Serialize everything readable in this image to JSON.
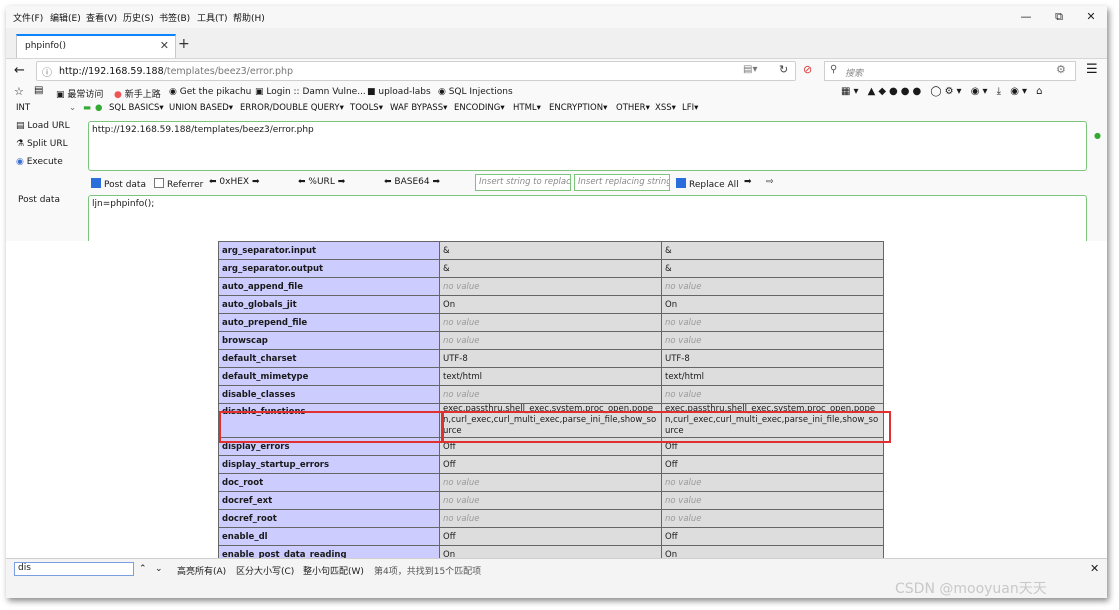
{
  "menubar": {
    "items": [
      "文件(F)",
      "编辑(E)",
      "查看(V)",
      "历史(S)",
      "书签(B)",
      "工具(T)",
      "帮助(H)"
    ]
  },
  "tab": {
    "title": "phpinfo()"
  },
  "nav": {
    "url_host": "http://192.168.59.188",
    "url_path": "/templates/beez3/error.php",
    "search_placeholder": "搜索"
  },
  "bookmarks": [
    "最常访问",
    "新手上路",
    "Get the pikachu",
    "Login :: Damn Vulne...",
    "upload-labs",
    "SQL Injections"
  ],
  "hackbar": {
    "type_select": "INT",
    "menu": [
      "SQL BASICS",
      "UNION BASED",
      "ERROR/DOUBLE QUERY",
      "TOOLS",
      "WAF BYPASS",
      "ENCODING",
      "HTML",
      "ENCRYPTION",
      "OTHER",
      "XSS",
      "LFI"
    ],
    "load_url": "Load URL",
    "split_url": "Split URL",
    "execute": "Execute",
    "url_value": "http://192.168.59.188/templates/beez3/error.php",
    "post_data_label": "Post data",
    "referrer_label": "Referrer",
    "hex_label": "0xHEX",
    "url_enc_label": "%URL",
    "base64_label": "BASE64",
    "insert_string_placeholder": "Insert string to replace",
    "insert_replacing_placeholder": "Insert replacing string",
    "replace_all_label": "Replace All",
    "post_side_label": "Post data",
    "post_value": "ljn=phpinfo();"
  },
  "phpinfo": {
    "rows": [
      {
        "key": "arg_separator.input",
        "local": "&",
        "master": "&"
      },
      {
        "key": "arg_separator.output",
        "local": "&",
        "master": "&"
      },
      {
        "key": "auto_append_file",
        "local": "no value",
        "master": "no value"
      },
      {
        "key": "auto_globals_jit",
        "local": "On",
        "master": "On"
      },
      {
        "key": "auto_prepend_file",
        "local": "no value",
        "master": "no value"
      },
      {
        "key": "browscap",
        "local": "no value",
        "master": "no value"
      },
      {
        "key": "default_charset",
        "local": "UTF-8",
        "master": "UTF-8"
      },
      {
        "key": "default_mimetype",
        "local": "text/html",
        "master": "text/html"
      },
      {
        "key": "disable_classes",
        "local": "no value",
        "master": "no value"
      },
      {
        "key": "disable_functions",
        "local": "exec,passthru,shell_exec,system,proc_open,popen,curl_exec,curl_multi_exec,parse_ini_file,show_source",
        "master": "exec,passthru,shell_exec,system,proc_open,popen,curl_exec,curl_multi_exec,parse_ini_file,show_source"
      },
      {
        "key": "display_errors",
        "local": "Off",
        "master": "Off"
      },
      {
        "key": "display_startup_errors",
        "local": "Off",
        "master": "Off"
      },
      {
        "key": "doc_root",
        "local": "no value",
        "master": "no value"
      },
      {
        "key": "docref_ext",
        "local": "no value",
        "master": "no value"
      },
      {
        "key": "docref_root",
        "local": "no value",
        "master": "no value"
      },
      {
        "key": "enable_dl",
        "local": "Off",
        "master": "Off"
      },
      {
        "key": "enable_post_data_reading",
        "local": "On",
        "master": "On"
      }
    ]
  },
  "findbar": {
    "query": "dis",
    "highlight_all": "高亮所有(A)",
    "match_case": "区分大小写(C)",
    "whole_words": "整小句匹配(W)",
    "status": "第4项，共找到15个匹配项"
  },
  "watermark": "CSDN @mooyuan天天"
}
